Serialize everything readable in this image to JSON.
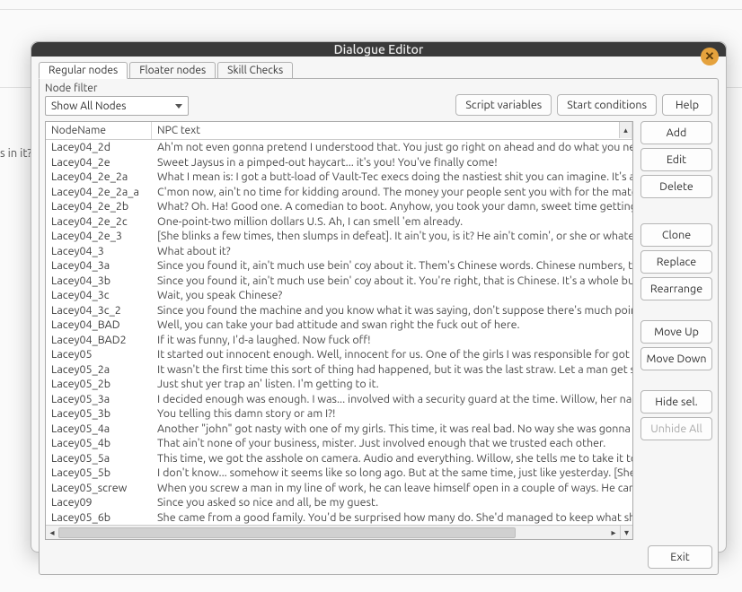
{
  "background": {
    "partial_text": "s in it?"
  },
  "window": {
    "title": "Dialogue Editor"
  },
  "tabs": [
    {
      "label": "Regular nodes",
      "active": true
    },
    {
      "label": "Floater nodes",
      "active": false
    },
    {
      "label": "Skill Checks",
      "active": false
    }
  ],
  "filter": {
    "label": "Node filter",
    "selected": "Show All Nodes"
  },
  "top_buttons": {
    "script_vars": "Script variables",
    "start_cond": "Start conditions",
    "help": "Help"
  },
  "table": {
    "columns": {
      "name": "NodeName",
      "text": "NPC text"
    },
    "rows": [
      {
        "name": "Lacey04_2d",
        "text": "Ah'm not even gonna pretend I understood that. You just go right on ahead and do what you need to do,"
      },
      {
        "name": "Lacey04_2e",
        "text": "Sweet Jaysus in a pimped-out haycart... it's you! You've finally come!"
      },
      {
        "name": "Lacey04_2e_2a",
        "text": "What I mean is: I got a butt-load of Vault-Tec execs doing the nastiest shit you can imagine. It's all righ"
      },
      {
        "name": "Lacey04_2e_2a_a",
        "text": "C'mon now, ain't no time for kidding around. The money your people sent you with for the material I hav"
      },
      {
        "name": "Lacey04_2e_2b",
        "text": "What? Oh. Ha! Good one. A comedian to boot. Anyhow, you took your damn, sweet time getting here!"
      },
      {
        "name": "Lacey04_2e_2c",
        "text": "One-point-two million dollars U.S. Ah, I can smell 'em already."
      },
      {
        "name": "Lacey04_2e_3",
        "text": "[She blinks a few times, then slumps in defeat]. It ain't you, is it? He ain't comin', or she or whatever. No"
      },
      {
        "name": "Lacey04_3",
        "text": "What about it?"
      },
      {
        "name": "Lacey04_3a",
        "text": "Since you found it, ain't much use bein' coy about it. Them's Chinese words. Chinese numbers, to be exac"
      },
      {
        "name": "Lacey04_3b",
        "text": "Since you found it, ain't much use bein' coy about it. You're right, that is Chinese. It's a whole bunch of n"
      },
      {
        "name": "Lacey04_3c",
        "text": "Wait, you speak Chinese?"
      },
      {
        "name": "Lacey04_3c_2",
        "text": "Since you found the machine and you know what it was saying, don't suppose there's much point hiding t"
      },
      {
        "name": "Lacey04_BAD",
        "text": "Well, you can take your bad attitude and swan right the fuck out of here."
      },
      {
        "name": "Lacey04_BAD2",
        "text": "If it was funny, I'd-a laughed. Now fuck off!"
      },
      {
        "name": "Lacey05",
        "text": "It started out innocent enough. Well, innocent for us. One of the girls I was responsible for got roughed"
      },
      {
        "name": "Lacey05_2a",
        "text": "It wasn't the first time this sort of thing had happened, but it was the last straw. Let a man get steamin'"
      },
      {
        "name": "Lacey05_2b",
        "text": "Just shut yer trap an' listen. I'm getting to it."
      },
      {
        "name": "Lacey05_3a",
        "text": "I decided enough was enough. I was... involved with a security guard at the time. Willow, her name was."
      },
      {
        "name": "Lacey05_3b",
        "text": "You telling this damn story or am I?!"
      },
      {
        "name": "Lacey05_4a",
        "text": "Another \"john\" got nasty with one of my girls. This time, it was real bad. No way she was gonna earn mo"
      },
      {
        "name": "Lacey05_4b",
        "text": "That ain't none of your business, mister. Just involved enough that we trusted each other."
      },
      {
        "name": "Lacey05_5a",
        "text": "This time, we got the asshole on camera. Audio and everything. Willow, she tells me to take it to the pol"
      },
      {
        "name": "Lacey05_5b",
        "text": "I don't know... somehow it seems like so long ago. But at the same time, just like yesterday. [She looks a"
      },
      {
        "name": "Lacey05_screw",
        "text": "When you screw a man in my line of work, he can leave himself open in a couple of ways. He can get you"
      },
      {
        "name": "Lacey09",
        "text": "Since you asked so nice and all, be my guest."
      },
      {
        "name": "Lacey05_6b",
        "text": "She came from a good family. You'd be surprised how many do. She'd managed to keep what she did to e"
      }
    ]
  },
  "side_buttons": {
    "add": "Add",
    "edit": "Edit",
    "delete": "Delete",
    "clone": "Clone",
    "replace": "Replace",
    "rearrange": "Rearrange",
    "move_up": "Move Up",
    "move_down": "Move Down",
    "hide_sel": "Hide sel.",
    "unhide_all": "Unhide All"
  },
  "footer": {
    "exit": "Exit"
  }
}
